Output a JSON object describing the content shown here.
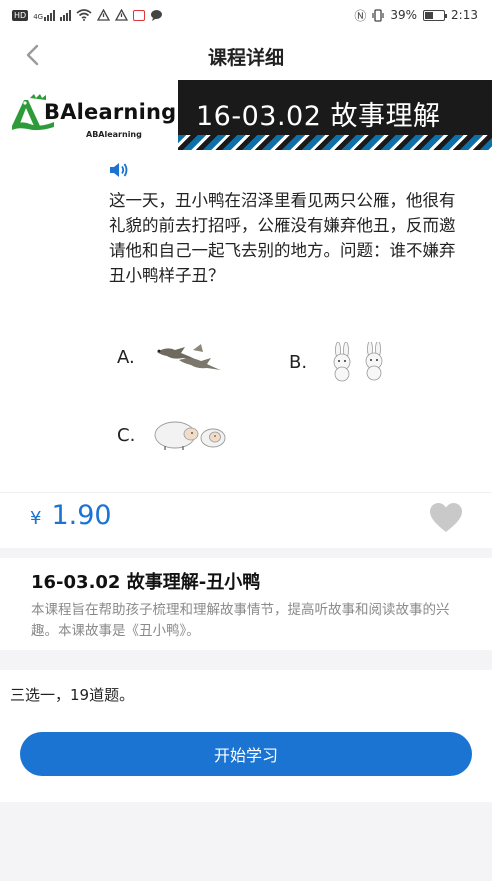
{
  "status_bar": {
    "network_badge": "HD",
    "network_type": "4G",
    "battery_percent": "39%",
    "time": "2:13"
  },
  "header": {
    "title": "课程详细",
    "back_icon": "chevron-left-icon"
  },
  "banner": {
    "logo_letter": "A",
    "logo_text": "BAlearning",
    "logo_subtext": "ABAlearning",
    "lesson_text": "16-03.02 故事理解"
  },
  "question": {
    "audio_icon": "speaker-icon",
    "text": "这一天，丑小鸭在沼泽里看见两只公雁，他很有礼貌的前去打招呼，公雁没有嫌弃他丑，反而邀请他和自己一起飞去别的地方。问题：谁不嫌弃丑小鸭样子丑？",
    "options": [
      {
        "label": "A.",
        "picture": "geese"
      },
      {
        "label": "B.",
        "picture": "rabbits"
      },
      {
        "label": "C.",
        "picture": "sheep"
      }
    ]
  },
  "price": {
    "currency": "¥",
    "amount": "1.90",
    "favorite_icon": "heart-icon"
  },
  "course": {
    "title": "16-03.02 故事理解-丑小鸭",
    "description": "本课程旨在帮助孩子梳理和理解故事情节，提高听故事和阅读故事的兴趣。本课故事是《丑小鸭》。"
  },
  "summary": {
    "question_count_text": "三选一，19道题。"
  },
  "actions": {
    "start_label": "开始学习"
  },
  "colors": {
    "accent": "#1b73d2",
    "banner_dark": "#1a1a1a",
    "logo_green": "#2e9b3a"
  }
}
